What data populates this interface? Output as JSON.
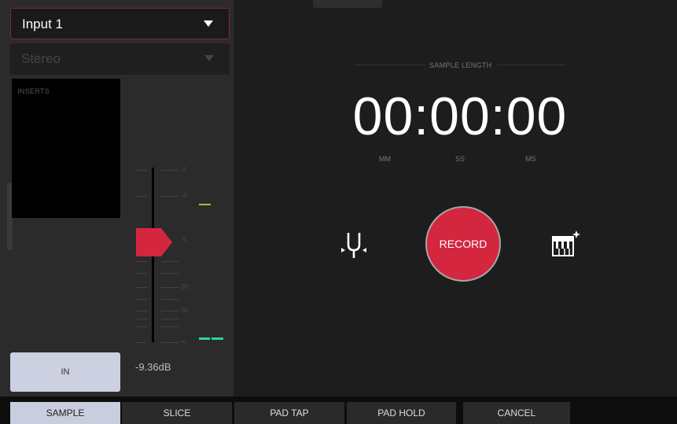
{
  "input_select": {
    "value": "Input 1"
  },
  "mode_select": {
    "value": "Stereo"
  },
  "inserts": {
    "label": "INSERTS"
  },
  "fader": {
    "scale": [
      "0",
      "-3",
      "-9",
      "-20",
      "-30",
      "-∞"
    ],
    "level_db": "-9.36dB"
  },
  "in_button": {
    "label": "IN"
  },
  "sample_length": {
    "label": "SAMPLE LENGTH",
    "time": "00:00:00",
    "units": [
      "MM",
      "SS",
      "MS"
    ]
  },
  "record_button": {
    "label": "RECORD"
  },
  "icons": {
    "tuner": "tuning-fork-icon",
    "piano": "piano-keys-icon"
  },
  "colors": {
    "record": "#d4263f",
    "active_tab": "#c9cedf",
    "meter": "#2fd3a4",
    "peak": "#b8b82c"
  },
  "tabs": [
    {
      "label": "SAMPLE",
      "active": true
    },
    {
      "label": "SLICE",
      "active": false
    },
    {
      "label": "PAD TAP",
      "active": false
    },
    {
      "label": "PAD HOLD",
      "active": false
    },
    {
      "label": "CANCEL",
      "active": false
    }
  ]
}
